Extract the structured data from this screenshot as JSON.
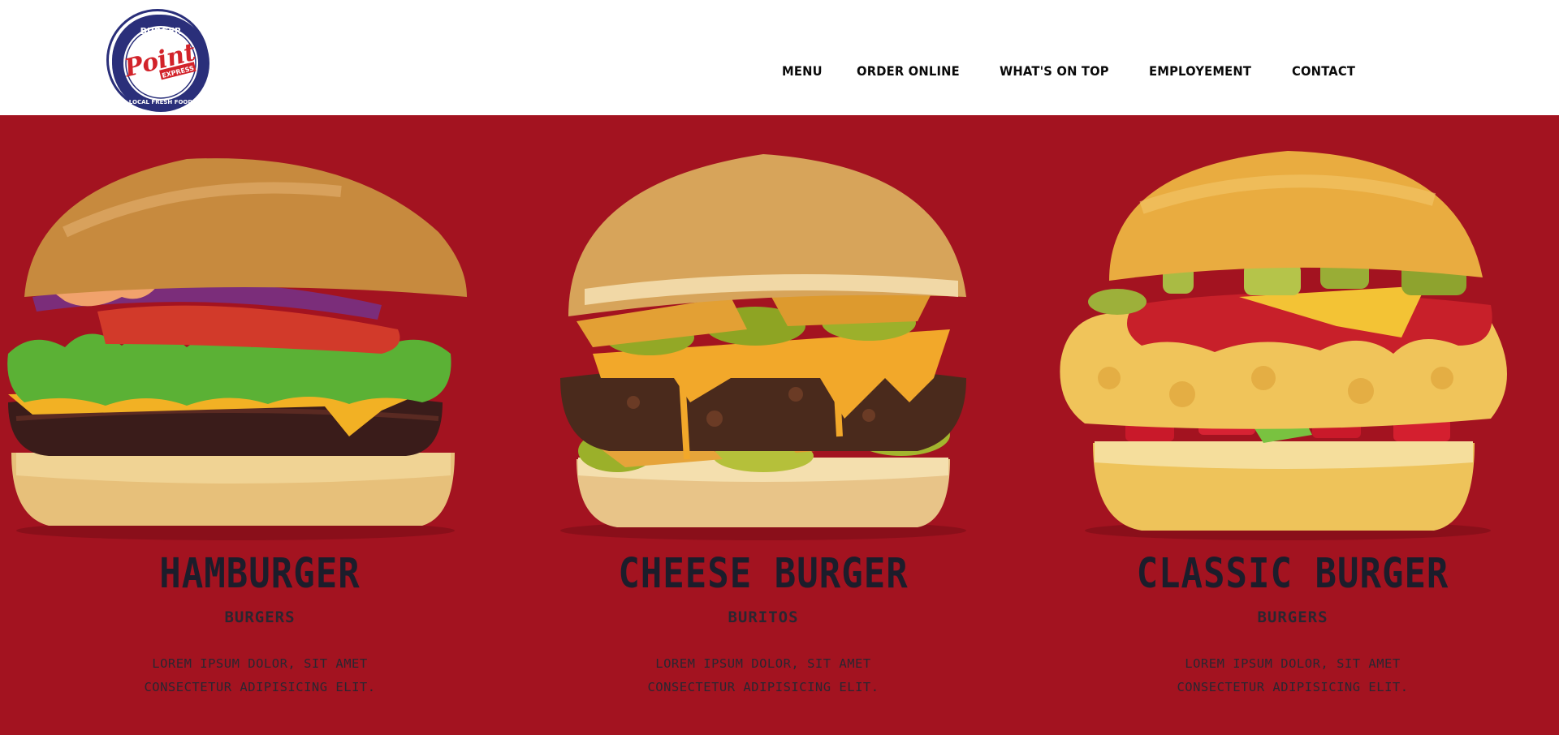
{
  "header": {
    "logo": {
      "top_text": "BURGER",
      "main_text": "Point",
      "sub_text": "EXPRESS",
      "bottom_text": "LOCAL FRESH FOOD"
    },
    "nav": [
      {
        "label": "MENU"
      },
      {
        "label": "ORDER ONLINE"
      },
      {
        "label": "WHAT'S ON TOP"
      },
      {
        "label": "EMPLOYEMENT"
      },
      {
        "label": "CONTACT"
      }
    ]
  },
  "colors": {
    "hero_bg": "#a31320",
    "text_dark": "#1c1d2b",
    "logo_blue": "#2a2f7a",
    "logo_red": "#d2232a"
  },
  "products": [
    {
      "title": "HAMBURGER",
      "category": "BURGERS",
      "desc_line1": "LOREM IPSUM DOLOR, SIT AMET",
      "desc_line2": "CONSECTETUR ADIPISICING ELIT.",
      "image": "hamburger-image"
    },
    {
      "title": "CHEESE BURGER",
      "category": "BURITOS",
      "desc_line1": "LOREM IPSUM DOLOR, SIT AMET",
      "desc_line2": "CONSECTETUR ADIPISICING ELIT.",
      "image": "cheese-burger-image"
    },
    {
      "title": "CLASSIC BURGER",
      "category": "BURGERS",
      "desc_line1": "LOREM IPSUM DOLOR, SIT AMET",
      "desc_line2": "CONSECTETUR ADIPISICING ELIT.",
      "image": "classic-burger-image"
    }
  ]
}
